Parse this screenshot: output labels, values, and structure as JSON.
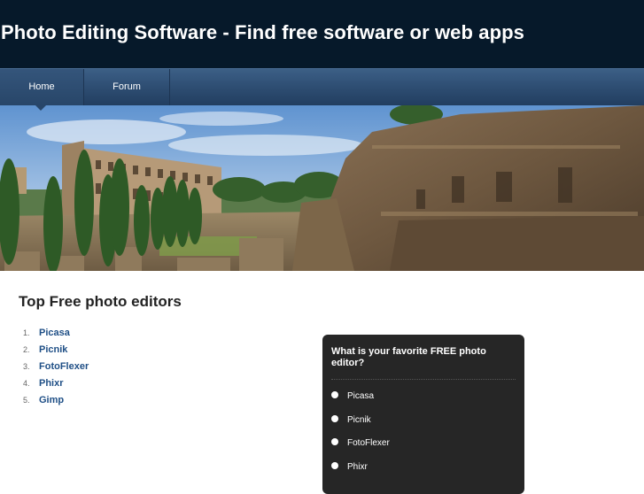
{
  "header": {
    "title": "Photo Editing Software - Find free software or web apps"
  },
  "nav": {
    "items": [
      {
        "label": "Home",
        "active": true
      },
      {
        "label": "Forum",
        "active": false
      }
    ]
  },
  "banner": {
    "description_icon": "colosseum-photo"
  },
  "main": {
    "section_title": "Top Free photo editors",
    "list": [
      {
        "num": "1.",
        "label": "Picasa"
      },
      {
        "num": "2.",
        "label": "Picnik"
      },
      {
        "num": "3.",
        "label": "FotoFlexer"
      },
      {
        "num": "4.",
        "label": "Phixr"
      },
      {
        "num": "5.",
        "label": "Gimp"
      }
    ]
  },
  "poll": {
    "question": "What is your favorite FREE photo editor?",
    "options": [
      "Picasa",
      "Picnik",
      "FotoFlexer",
      "Phixr"
    ]
  },
  "colors": {
    "header_bg": "#06192a",
    "nav_bg": "#2f4f74",
    "link": "#1f4f86",
    "poll_bg": "#262626"
  }
}
